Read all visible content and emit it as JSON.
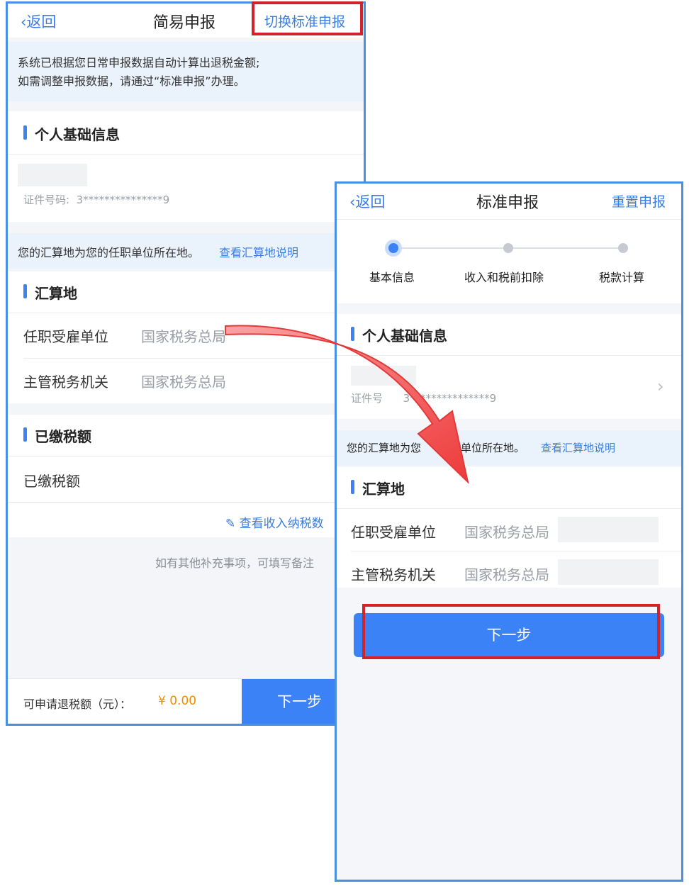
{
  "left": {
    "nav": {
      "back": "返回",
      "title": "简易申报",
      "switch": "切换标准申报"
    },
    "notice": {
      "line1": "系统已根据您日常申报数据自动计算出退税金额;",
      "line2": "如需调整申报数据，请通过“标准申报”办理。"
    },
    "personal": {
      "title": "个人基础信息",
      "id_label": "证件号码:",
      "id_value": "3***************9"
    },
    "location_hint": {
      "text": "您的汇算地为您的任职单位所在地。",
      "link": "查看汇算地说明"
    },
    "settlement": {
      "title": "汇算地",
      "rows": [
        {
          "label": "任职受雇单位",
          "value": "国家税务总局"
        },
        {
          "label": "主管税务机关",
          "value": "国家税务总局"
        }
      ]
    },
    "paid": {
      "title": "已缴税额",
      "row_label": "已缴税额"
    },
    "view_income": "查看收入纳税数",
    "remark_hint": "如有其他补充事项，可填写备注",
    "bottom": {
      "refund_label": "可申请退税额（元）：",
      "refund_value": "¥ 0.00",
      "next": "下一步"
    }
  },
  "right": {
    "nav": {
      "back": "返回",
      "title": "标准申报",
      "reset": "重置申报"
    },
    "steps": [
      "基本信息",
      "收入和税前扣除",
      "税款计算"
    ],
    "personal": {
      "title": "个人基础信息",
      "id_label": "证件号",
      "id_value": "3***************9"
    },
    "location_hint": {
      "text_a": "您的汇算地为您",
      "text_b": "职单位所在地。",
      "link": "查看汇算地说明"
    },
    "settlement": {
      "title": "汇算地",
      "rows": [
        {
          "label": "任职受雇单位",
          "value": "国家税务总局"
        },
        {
          "label": "主管税务机关",
          "value": "国家税务总局"
        }
      ]
    },
    "next": "下一步"
  },
  "colors": {
    "accent": "#3b82f6",
    "highlight": "#d2232a",
    "arrow": "#f04a4a",
    "amount": "#f08c00"
  }
}
